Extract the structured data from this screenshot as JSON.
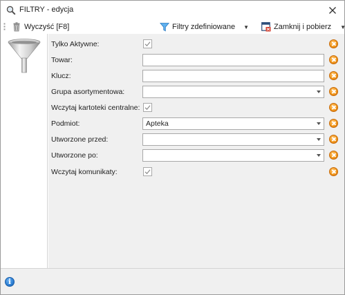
{
  "window": {
    "title": "FILTRY - edycja"
  },
  "toolbar": {
    "clear_label": "Wyczyść [F8]",
    "predefined_filters_label": "Filtry zdefiniowane",
    "close_fetch_label": "Zamknij i pobierz"
  },
  "form": {
    "rows": [
      {
        "label": "Tylko Aktywne:",
        "type": "checkbox",
        "checked": true
      },
      {
        "label": "Towar:",
        "type": "text",
        "value": ""
      },
      {
        "label": "Klucz:",
        "type": "text",
        "value": ""
      },
      {
        "label": "Grupa asortymentowa:",
        "type": "combo",
        "value": ""
      },
      {
        "label": "Wczytaj kartoteki centralne:",
        "type": "checkbox",
        "checked": true
      },
      {
        "label": "Podmiot:",
        "type": "combo",
        "value": "Apteka"
      },
      {
        "label": "Utworzone przed:",
        "type": "combo",
        "value": ""
      },
      {
        "label": "Utworzone po:",
        "type": "combo",
        "value": ""
      },
      {
        "label": "Wczytaj komunikaty:",
        "type": "checkbox",
        "checked": true
      }
    ]
  },
  "icons": {
    "title": "search-magnifier-icon",
    "close": "close-icon",
    "clear": "trash-can-icon",
    "filters": "funnel-icon",
    "close_fetch": "window-close-fetch-icon",
    "side": "funnel-icon",
    "clear_field": "clear-field-icon",
    "info": "info-icon"
  },
  "colors": {
    "form_background": "#f0f0f0",
    "clear_field": "#f39a1e",
    "info": "#2d7fd3",
    "filter_funnel": "#2e8fd8",
    "close_fetch_red": "#d23a2a"
  }
}
